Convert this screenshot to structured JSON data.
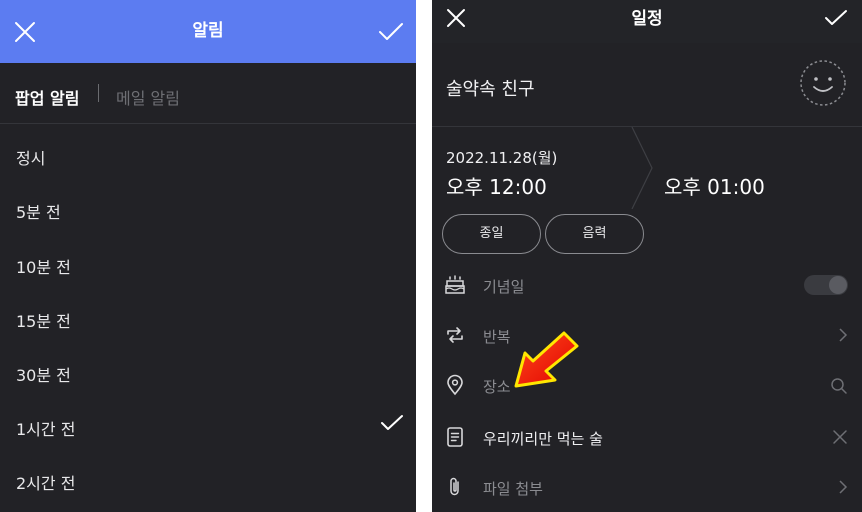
{
  "left": {
    "header": {
      "title": "알림"
    },
    "tabs": {
      "popup": "팝업 알림",
      "mail": "메일 알림"
    },
    "options": [
      {
        "label": "정시",
        "selected": false
      },
      {
        "label": "5분 전",
        "selected": false
      },
      {
        "label": "10분 전",
        "selected": false
      },
      {
        "label": "15분 전",
        "selected": false
      },
      {
        "label": "30분 전",
        "selected": false
      },
      {
        "label": "1시간 전",
        "selected": true
      },
      {
        "label": "2시간 전",
        "selected": false
      }
    ]
  },
  "right": {
    "header": {
      "title": "일정"
    },
    "event_title": "술약속 친구",
    "start": {
      "date": "2022.11.28(월)",
      "time": "오후 12:00"
    },
    "end": {
      "time": "오후 01:00"
    },
    "pills": {
      "all_day": "종일",
      "lunar": "음력"
    },
    "anniversary": {
      "label": "기념일",
      "toggle_on": false
    },
    "repeat": {
      "label": "반복"
    },
    "location": {
      "label": "장소"
    },
    "memo": {
      "label": "우리끼리만 먹는 술"
    },
    "attachment": {
      "label": "파일 첨부"
    }
  },
  "colors": {
    "header_blue": "#5c7cf1",
    "background": "#222226",
    "annotation_arrow": "#ff1a0a",
    "annotation_glow": "#ffe600"
  }
}
